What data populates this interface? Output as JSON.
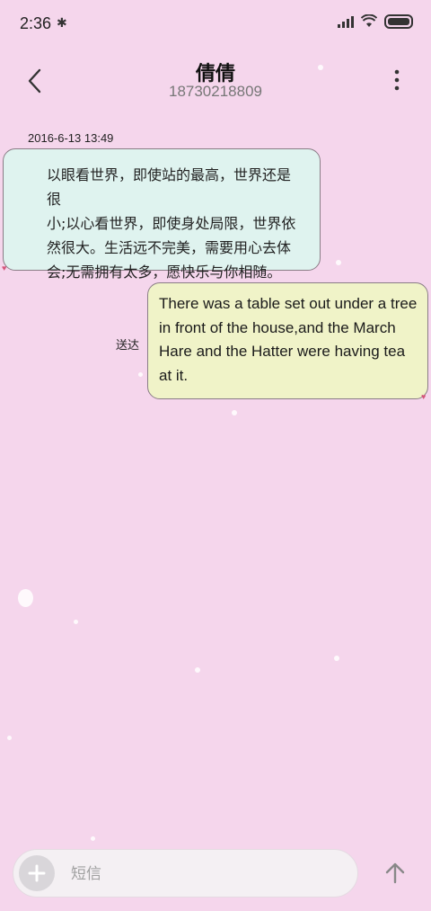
{
  "status_bar": {
    "time": "2:36",
    "icons": [
      "bluetooth-icon",
      "signal-icon",
      "wifi-icon",
      "battery-icon"
    ]
  },
  "header": {
    "title": "倩倩",
    "phone": "18730218809",
    "icons": [
      "back-arrow-icon",
      "more-vertical-icon"
    ]
  },
  "conversation": {
    "timestamp": "2016-6-13 13:49",
    "messages": [
      {
        "direction": "incoming",
        "lines": [
          "以眼看世界，即使站的最高，世界还是很",
          "小;以心看世界，即使身处局限，世界依",
          "然很大。生活远不完美，需要用心去体",
          "会;无需拥有太多，愿快乐与你相随。"
        ]
      },
      {
        "direction": "outgoing",
        "status": "送达",
        "lines": [
          "There was a table set out under a tree",
          "in front of the house,and the March",
          "Hare and the Hatter were having tea",
          "at it."
        ]
      }
    ]
  },
  "composer": {
    "placeholder": "短信",
    "value": "",
    "icons": [
      "add-icon",
      "send-arrow-icon"
    ]
  },
  "colors": {
    "background": "#f5d6ec",
    "incoming_bubble": "#dff3ef",
    "outgoing_bubble": "#f0f3c8",
    "bubble_border": "#8a7d86"
  }
}
